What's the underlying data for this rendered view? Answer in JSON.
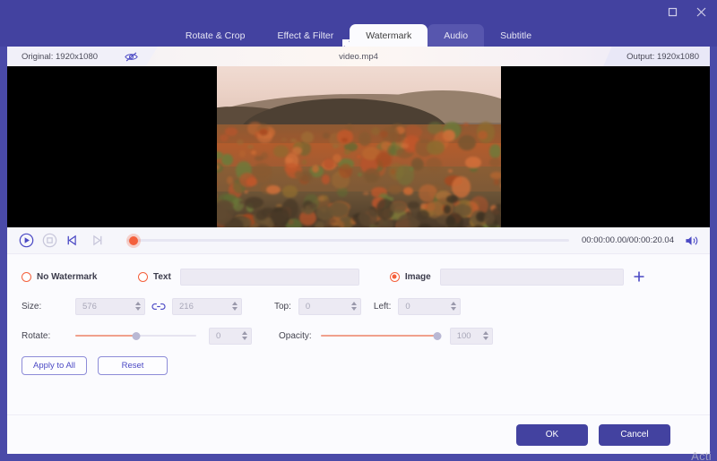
{
  "window": {
    "controls": [
      {
        "name": "maximize-button",
        "icon": "maximize-icon"
      },
      {
        "name": "close-button",
        "icon": "close-icon"
      }
    ]
  },
  "tabs": [
    {
      "label": "Rotate & Crop",
      "state": "normal"
    },
    {
      "label": "Effect & Filter",
      "state": "normal"
    },
    {
      "label": "Watermark",
      "state": "active"
    },
    {
      "label": "Audio",
      "state": "hover"
    },
    {
      "label": "Subtitle",
      "state": "normal"
    }
  ],
  "infobar": {
    "original_label": "Original: 1920x1080",
    "output_label": "Output: 1920x1080",
    "filename": "video.mp4",
    "eye_icon": "eye-off-icon"
  },
  "player": {
    "play_icon": "play-circle-icon",
    "stop_icon": "stop-circle-icon",
    "prev_frame_icon": "previous-frame-icon",
    "next_frame_icon": "next-frame-icon",
    "timecode": "00:00:00.00/00:00:20.04",
    "current_time": "00:00:00.00",
    "duration": "00:00:20.04",
    "volume_icon": "volume-icon",
    "playhead_percent": 0
  },
  "watermark": {
    "options": [
      {
        "label": "No Watermark",
        "selected": false
      },
      {
        "label": "Text",
        "selected": false
      },
      {
        "label": "Image",
        "selected": true
      }
    ],
    "text_value": "",
    "text_placeholder": "",
    "image_value": "",
    "image_placeholder": "",
    "add_icon": "plus-icon",
    "size": {
      "label": "Size:",
      "width": "576",
      "height": "216",
      "link_icon": "link-chain-icon",
      "linked": true
    },
    "position": {
      "top_label": "Top:",
      "top_value": "0",
      "left_label": "Left:",
      "left_value": "0"
    },
    "rotate": {
      "label": "Rotate:",
      "value": "0",
      "percent": 50
    },
    "opacity": {
      "label": "Opacity:",
      "value": "100",
      "percent": 100
    },
    "apply_to_all_label": "Apply to All",
    "reset_label": "Reset"
  },
  "footer": {
    "ok_label": "OK",
    "cancel_label": "Cancel"
  },
  "overlay": {
    "activation_text": "Acti"
  },
  "colors": {
    "brand_purple": "#4342a0",
    "accent_blue": "#4b49c4",
    "radio_orange": "#f4603c",
    "panel_bg": "#fbfbfe",
    "input_bg": "#eceaf3",
    "slider_fill": "#f0a08c"
  }
}
